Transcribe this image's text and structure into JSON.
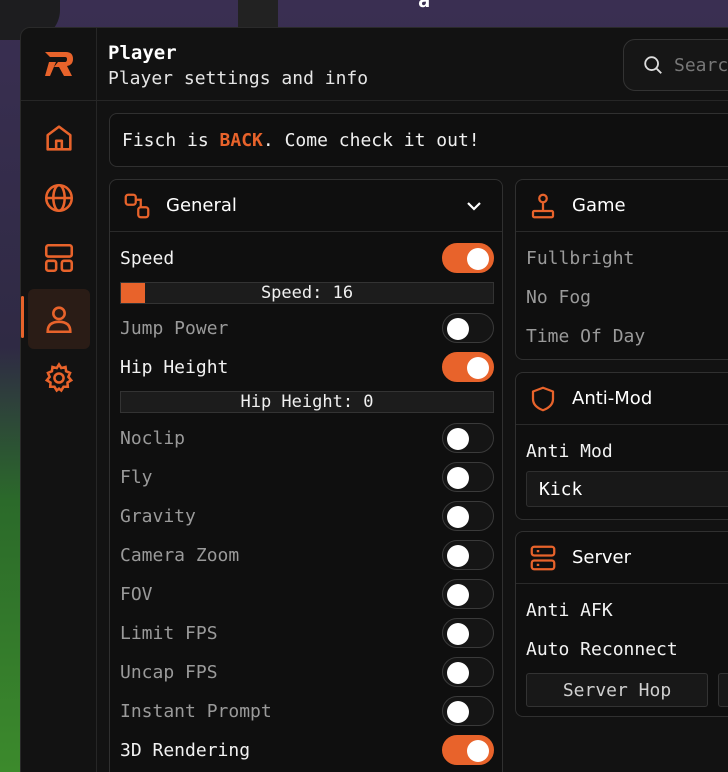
{
  "background": {
    "text": "a"
  },
  "header": {
    "title": "Player",
    "subtitle": "Player settings and info",
    "search_placeholder": "Search"
  },
  "sidebar": {
    "items": [
      {
        "icon": "home-icon",
        "active": false
      },
      {
        "icon": "globe-icon",
        "active": false
      },
      {
        "icon": "layout-icon",
        "active": false
      },
      {
        "icon": "user-icon",
        "active": true
      },
      {
        "icon": "gear-icon",
        "active": false
      }
    ]
  },
  "banner": {
    "prefix": "Fisch is ",
    "highlight": "BACK",
    "suffix": ". Come check it out!"
  },
  "general": {
    "title": "General",
    "speed": {
      "label": "Speed",
      "on": true
    },
    "speed_slider": {
      "label": "Speed: 16",
      "value": 16,
      "fill": 0.06
    },
    "jump_power": {
      "label": "Jump Power",
      "on": false
    },
    "hip_height": {
      "label": "Hip Height",
      "on": true
    },
    "hip_slider": {
      "label": "Hip Height: 0",
      "value": 0,
      "fill": 0
    },
    "noclip": {
      "label": "Noclip",
      "on": false
    },
    "fly": {
      "label": "Fly",
      "on": false
    },
    "gravity": {
      "label": "Gravity",
      "on": false
    },
    "camera_zoom": {
      "label": "Camera Zoom",
      "on": false
    },
    "fov": {
      "label": "FOV",
      "on": false
    },
    "limit_fps": {
      "label": "Limit FPS",
      "on": false
    },
    "uncap_fps": {
      "label": "Uncap FPS",
      "on": false
    },
    "instant_prompt": {
      "label": "Instant Prompt",
      "on": false
    },
    "rendering_3d": {
      "label": "3D Rendering",
      "on": true
    }
  },
  "game": {
    "title": "Game",
    "items": [
      "Fullbright",
      "No Fog",
      "Time Of Day"
    ]
  },
  "antimod": {
    "title": "Anti-Mod",
    "label": "Anti Mod",
    "selected": "Kick"
  },
  "server": {
    "title": "Server",
    "anti_afk": "Anti AFK",
    "auto_reconnect": "Auto Reconnect",
    "hop_button": "Server Hop"
  },
  "colors": {
    "accent": "#e8632b",
    "panel": "#0f0f0f",
    "window": "#121212"
  }
}
